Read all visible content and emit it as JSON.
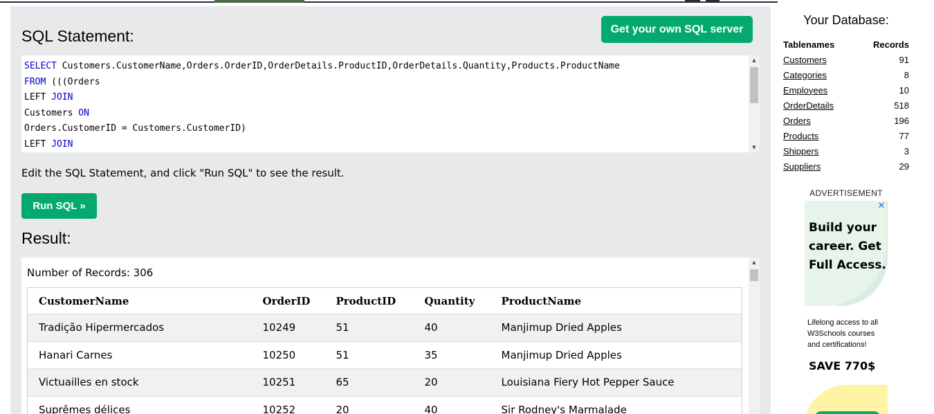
{
  "main": {
    "sql_title": "SQL Statement:",
    "get_server_label": "Get your own SQL server",
    "sql_lines": [
      [
        {
          "t": "SELECT",
          "k": true
        },
        {
          "t": " Customers.CustomerName,Orders.OrderID,OrderDetails.ProductID,OrderDetails.Quantity,Products.ProductName",
          "k": false
        }
      ],
      [
        {
          "t": "FROM",
          "k": true
        },
        {
          "t": " (((Orders",
          "k": false
        }
      ],
      [
        {
          "t": "LEFT ",
          "k": false
        },
        {
          "t": "JOIN",
          "k": true
        }
      ],
      [
        {
          "t": "Customers ",
          "k": false
        },
        {
          "t": "ON",
          "k": true
        }
      ],
      [
        {
          "t": "Orders.CustomerID = Customers.CustomerID)",
          "k": false
        }
      ],
      [
        {
          "t": "LEFT ",
          "k": false
        },
        {
          "t": "JOIN",
          "k": true
        }
      ]
    ],
    "edit_hint": "Edit the SQL Statement, and click \"Run SQL\" to see the result.",
    "run_label": "Run SQL »",
    "result_title": "Result:",
    "records_text": "Number of Records: 306",
    "columns": [
      "CustomerName",
      "OrderID",
      "ProductID",
      "Quantity",
      "ProductName"
    ],
    "rows": [
      [
        "Tradição Hipermercados",
        "10249",
        "51",
        "40",
        "Manjimup Dried Apples"
      ],
      [
        "Hanari Carnes",
        "10250",
        "51",
        "35",
        "Manjimup Dried Apples"
      ],
      [
        "Victuailles en stock",
        "10251",
        "65",
        "20",
        "Louisiana Fiery Hot Pepper Sauce"
      ],
      [
        "Suprêmes délices",
        "10252",
        "20",
        "40",
        "Sir Rodney's Marmalade"
      ]
    ]
  },
  "sidebar": {
    "title": "Your Database:",
    "col_tables": "Tablenames",
    "col_records": "Records",
    "tables": [
      {
        "name": "Customers",
        "records": "91"
      },
      {
        "name": "Categories",
        "records": "8"
      },
      {
        "name": "Employees",
        "records": "10"
      },
      {
        "name": "OrderDetails",
        "records": "518"
      },
      {
        "name": "Orders",
        "records": "196"
      },
      {
        "name": "Products",
        "records": "77"
      },
      {
        "name": "Shippers",
        "records": "3"
      },
      {
        "name": "Suppliers",
        "records": "29"
      }
    ],
    "ad_label": "ADVERTISEMENT",
    "ad_headline": "Build your career. Get Full Access.",
    "ad_body": "Lifelong access to all W3Schools courses and certifications!",
    "ad_save": "SAVE 770$",
    "ad_close": "✕"
  },
  "colors": {
    "accent_green": "#04aa6d",
    "panel_bg": "#e7e9eb",
    "sql_keyword": "#0000cd"
  }
}
